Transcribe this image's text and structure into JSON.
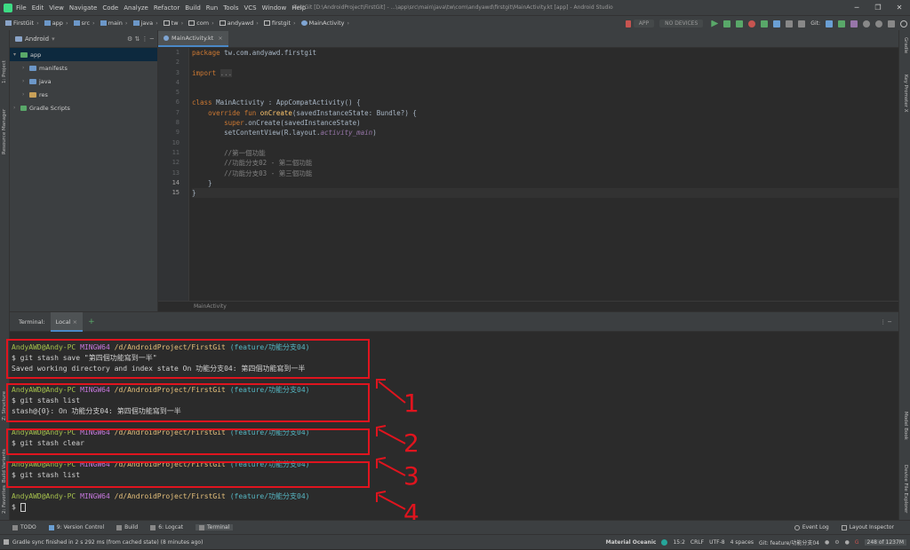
{
  "window": {
    "title": "FirstGit [D:\\AndroidProject\\FirstGit] - ...\\app\\src\\main\\java\\tw\\com\\andyawd\\firstgit\\MainActivity.kt [app] - Android Studio",
    "controls": [
      "─",
      "❐",
      "✕"
    ]
  },
  "menu": [
    "File",
    "Edit",
    "View",
    "Navigate",
    "Code",
    "Analyze",
    "Refactor",
    "Build",
    "Run",
    "Tools",
    "VCS",
    "Window",
    "Help"
  ],
  "breadcrumbs": [
    "FirstGit",
    "app",
    "src",
    "main",
    "java",
    "tw",
    "com",
    "andyawd",
    "firstgit",
    "MainActivity"
  ],
  "toolbar": {
    "config": "APP",
    "device": "NO DEVICES",
    "git": "Git:"
  },
  "left_tool_labels": [
    "1: Project",
    "Resource Manager",
    "Z: Structure",
    "Build Variants",
    "2: Favorites"
  ],
  "right_tool_labels": [
    "Gradle",
    "Key Promoter X",
    "Model Book",
    "Device File Explorer"
  ],
  "project": {
    "selector": "Android",
    "tree": [
      {
        "label": "app"
      },
      {
        "label": "manifests"
      },
      {
        "label": "java"
      },
      {
        "label": "res"
      },
      {
        "label": "Gradle Scripts"
      }
    ]
  },
  "editor": {
    "tab": "MainActivity.kt",
    "footer": "MainActivity",
    "line_numbers": [
      "1",
      "2",
      "3",
      "4",
      "5",
      "6",
      "7",
      "8",
      "9",
      "10",
      "11",
      "12",
      "13",
      "14",
      "15"
    ]
  },
  "terminal": {
    "label": "Terminal:",
    "tab": "Local",
    "lines": [
      {
        "user": "AndyAWD@Andy-PC",
        "host": "MINGW64",
        "path": "/d/AndroidProject/FirstGit",
        "branch": "(feature/功能分支04)"
      },
      {
        "text": "$ git stash save \"第四個功能寫到一半\""
      },
      {
        "text": "Saved working directory and index state On 功能分支04: 第四個功能寫到一半"
      },
      {
        "text": ""
      },
      {
        "user": "AndyAWD@Andy-PC",
        "host": "MINGW64",
        "path": "/d/AndroidProject/FirstGit",
        "branch": "(feature/功能分支04)"
      },
      {
        "text": "$ git stash list"
      },
      {
        "text": "stash@{0}: On 功能分支04: 第四個功能寫到一半"
      },
      {
        "text": ""
      },
      {
        "user": "AndyAWD@Andy-PC",
        "host": "MINGW64",
        "path": "/d/AndroidProject/FirstGit",
        "branch": "(feature/功能分支04)"
      },
      {
        "text": "$ git stash clear"
      },
      {
        "text": ""
      },
      {
        "user": "AndyAWD@Andy-PC",
        "host": "MINGW64",
        "path": "/d/AndroidProject/FirstGit",
        "branch": "(feature/功能分支04)"
      },
      {
        "text": "$ git stash list"
      },
      {
        "text": ""
      },
      {
        "user": "AndyAWD@Andy-PC",
        "host": "MINGW64",
        "path": "/d/AndroidProject/FirstGit",
        "branch": "(feature/功能分支04)"
      },
      {
        "text": "$ "
      }
    ]
  },
  "annotations": [
    "1",
    "2",
    "3",
    "4"
  ],
  "bottom_tools": [
    "TODO",
    "9: Version Control",
    "Build",
    "6: Logcat",
    "Terminal",
    "Event Log",
    "Layout Inspector"
  ],
  "status": {
    "message": "Gradle sync finished in 2 s 292 ms (from cached state) (8 minutes ago)",
    "theme": "Material Oceanic",
    "position": "15:2",
    "line_sep": "CRLF",
    "encoding": "UTF-8",
    "indent": "4 spaces",
    "branch": "Git: feature/功能分支04",
    "memory": "248 of 1237M"
  },
  "colors": {
    "accent": "#4a88c7",
    "annotation_red": "#e0141e"
  }
}
